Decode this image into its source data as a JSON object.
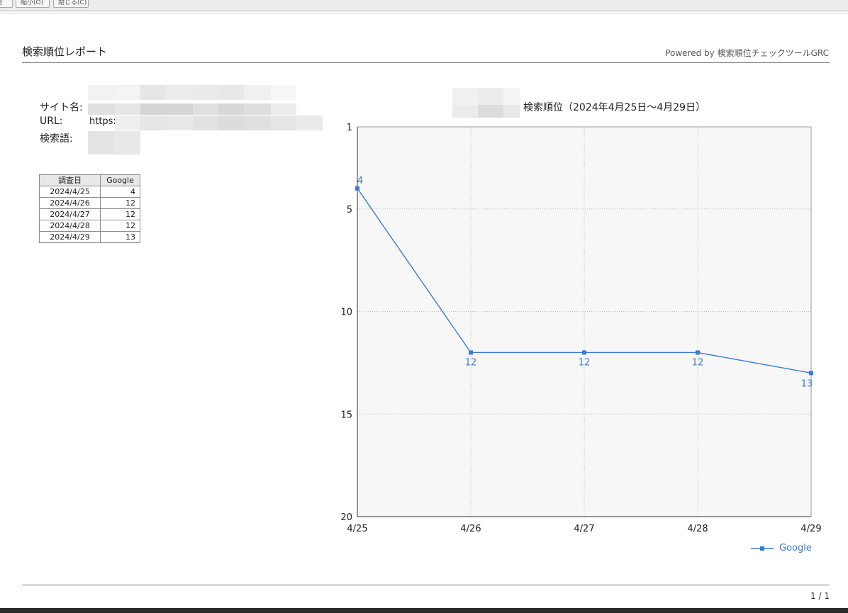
{
  "toolbar": {
    "buttons": [
      "印刷",
      "縮小(O)",
      "閉じる(C)"
    ]
  },
  "header": {
    "title": "検索順位レポート",
    "powered_by": "Powered by 検索順位チェックツールGRC"
  },
  "site_info": {
    "site_name_label": "サイト名:",
    "url_label": "URL:",
    "url_value": "https:",
    "keyword_label": "検索語:"
  },
  "table": {
    "headers": [
      "調査日",
      "Google"
    ],
    "rows": [
      [
        "2024/4/25",
        "4"
      ],
      [
        "2024/4/26",
        "12"
      ],
      [
        "2024/4/27",
        "12"
      ],
      [
        "2024/4/28",
        "12"
      ],
      [
        "2024/4/29",
        "13"
      ]
    ]
  },
  "colors": {
    "series": "#3a7bd5",
    "plot_bg": "#f7f7f7",
    "grid": "#bdbdbd"
  },
  "chart_data": {
    "type": "line",
    "title": "検索順位（2024年4月25日〜4月29日）",
    "categories": [
      "4/25",
      "4/26",
      "4/27",
      "4/28",
      "4/29"
    ],
    "series": [
      {
        "name": "Google",
        "values": [
          4,
          12,
          12,
          12,
          13
        ]
      }
    ],
    "y_ticks": [
      "1",
      "5",
      "10",
      "15",
      "20"
    ],
    "ylim": [
      1,
      20
    ],
    "y_inverted": true,
    "grid": true,
    "legend": "bottom-right"
  },
  "footer": {
    "page": "1 / 1"
  }
}
